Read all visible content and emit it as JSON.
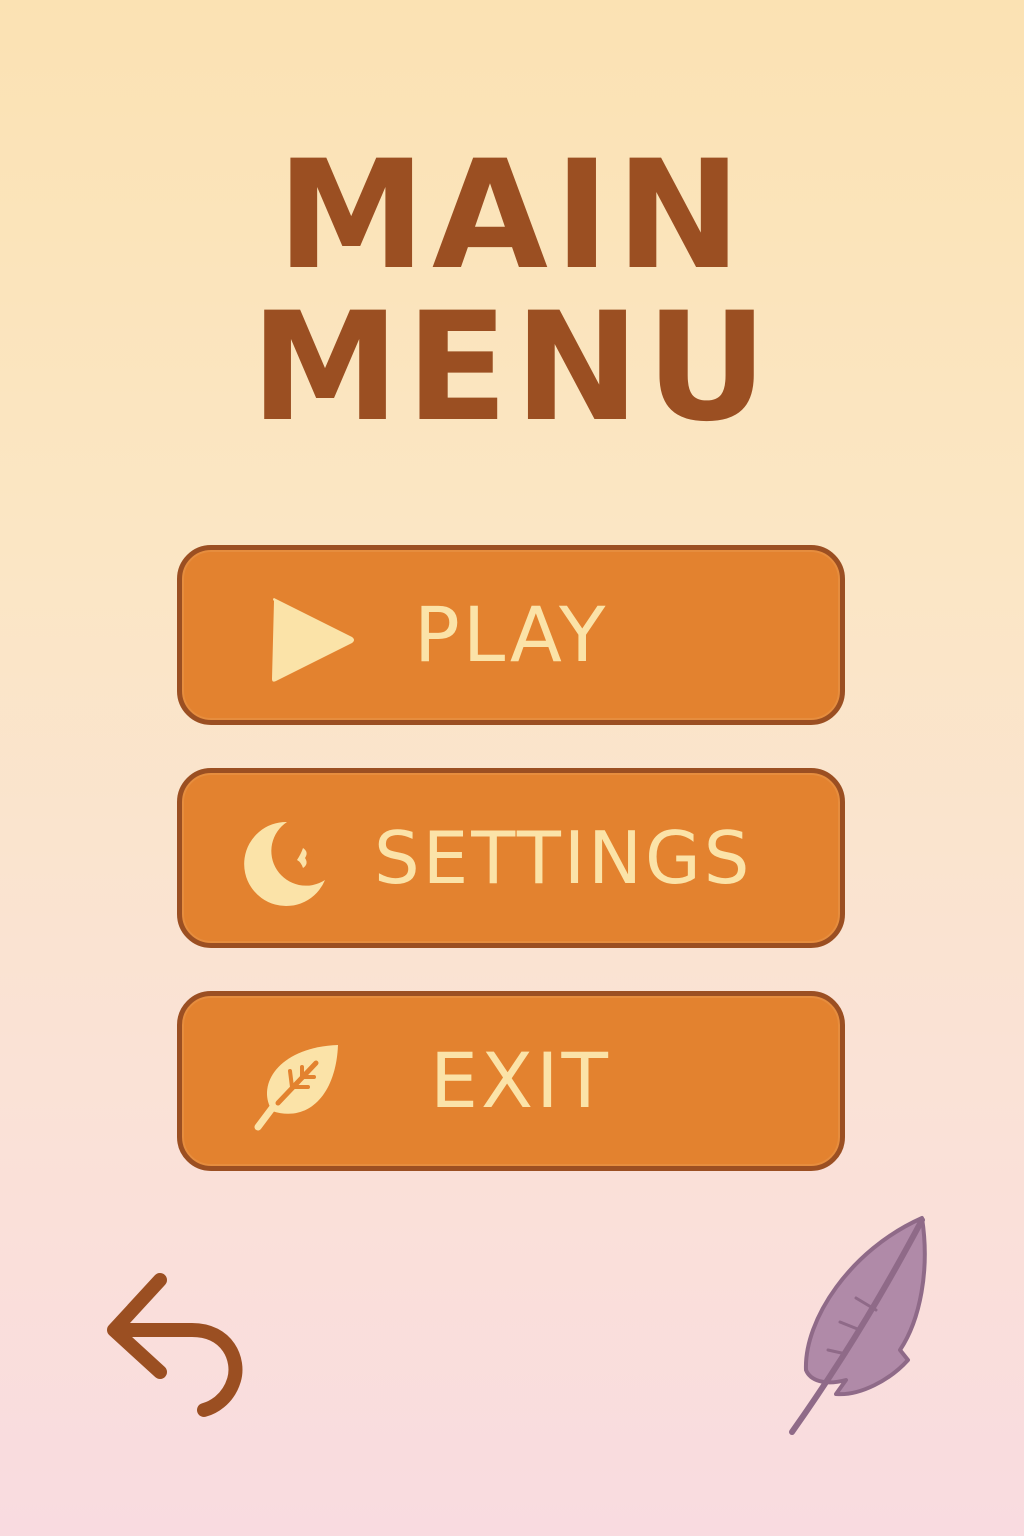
{
  "title": {
    "line1": "MAIN",
    "line2": "MENU"
  },
  "buttons": {
    "play": {
      "label": "PLAY",
      "icon": "play-icon"
    },
    "settings": {
      "label": "SETTINGS",
      "icon": "moon-icon"
    },
    "exit": {
      "label": "EXIT",
      "icon": "leaf-icon"
    }
  },
  "footer": {
    "back_icon": "back-arrow-icon",
    "feather_icon": "feather-icon"
  },
  "colors": {
    "title": "#9b4f22",
    "button_fill": "#e3822f",
    "button_border": "#9b4f22",
    "button_text": "#fbe3a8",
    "feather": "#b08aa8"
  }
}
